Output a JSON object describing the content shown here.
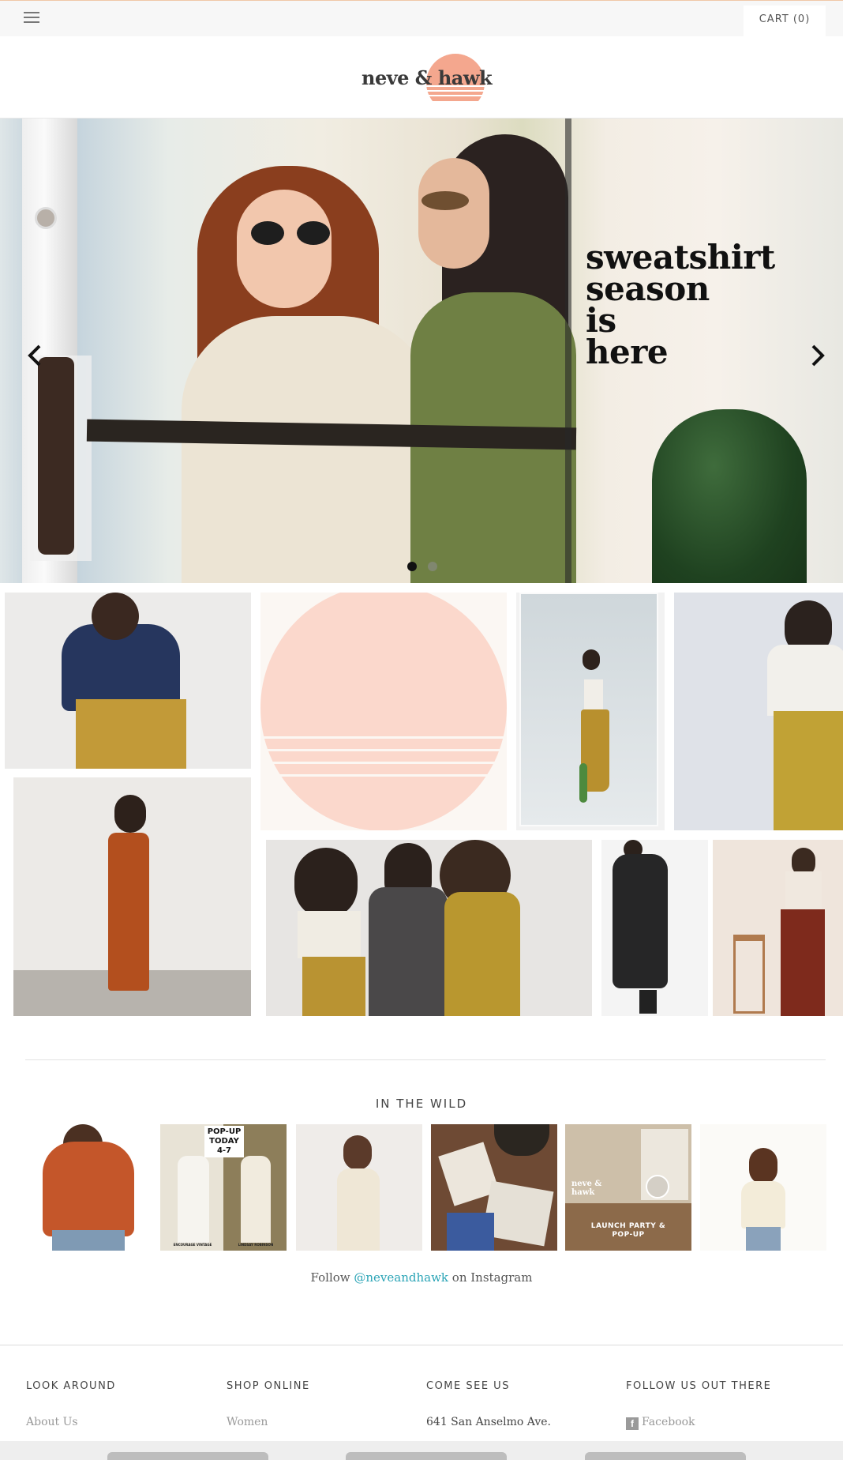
{
  "header": {
    "cart_label": "CART (0)"
  },
  "logo": {
    "text": "neve & hawk"
  },
  "hero": {
    "headline": [
      "sweatshirt",
      "season",
      "is",
      "here"
    ],
    "slides_total": 2,
    "active_slide": 1
  },
  "in_the_wild": {
    "title": "IN THE WILD",
    "tiles": [
      {
        "label": ""
      },
      {
        "label": "POP-UP TODAY 4-7",
        "sub_left": "ENCOURAGE VINTAGE",
        "sub_right": "LINDSAY ROBINSON"
      },
      {
        "label": ""
      },
      {
        "label": ""
      },
      {
        "label": "LAUNCH PARTY & POP-UP",
        "brand": "neve & hawk"
      },
      {
        "label": ""
      }
    ],
    "follow_prefix": "Follow ",
    "follow_handle": "@neveandhawk",
    "follow_suffix": " on Instagram"
  },
  "footer": {
    "columns": [
      {
        "heading": "LOOK AROUND",
        "link": "About Us"
      },
      {
        "heading": "SHOP ONLINE",
        "link": "Women"
      },
      {
        "heading": "COME SEE US",
        "link": "641 San Anselmo Ave."
      },
      {
        "heading": "FOLLOW US OUT THERE",
        "link": "Facebook"
      }
    ]
  },
  "colors": {
    "accent_sun": "#f4a78e",
    "sun_tile": "#fbd8cc",
    "link": "#2aa4b6"
  }
}
